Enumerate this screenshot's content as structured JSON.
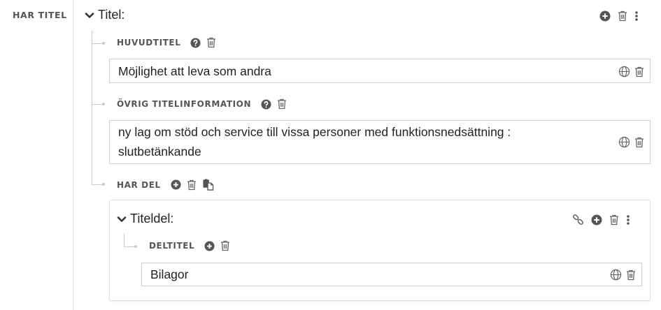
{
  "left_label": "HAR TITEL",
  "title_block": {
    "heading": "Titel:",
    "huvudtitel": {
      "label": "HUVUDTITEL",
      "value": "Möjlighet att leva som andra"
    },
    "ovrig": {
      "label": "ÖVRIG TITELINFORMATION",
      "line1": "ny lag om stöd och service till vissa personer med funktionsnedsättning  :",
      "line2": "slutbetänkande"
    },
    "har_del": {
      "label": "HAR DEL",
      "card": {
        "heading": "Titeldel:",
        "deltitel": {
          "label": "DELTITEL",
          "value": "Bilagor"
        }
      }
    }
  },
  "icons": {
    "add": "plus-circle-icon",
    "delete": "trash-icon",
    "more": "more-vertical-icon",
    "help": "question-circle-icon",
    "language": "globe-icon",
    "link": "link-icon",
    "paste": "paste-icon",
    "expand": "chevron-down-icon"
  },
  "colors": {
    "icon": "#666666",
    "label": "#555555",
    "text": "#222222",
    "border": "#cfcfcf",
    "tree": "#c9c9c9"
  }
}
